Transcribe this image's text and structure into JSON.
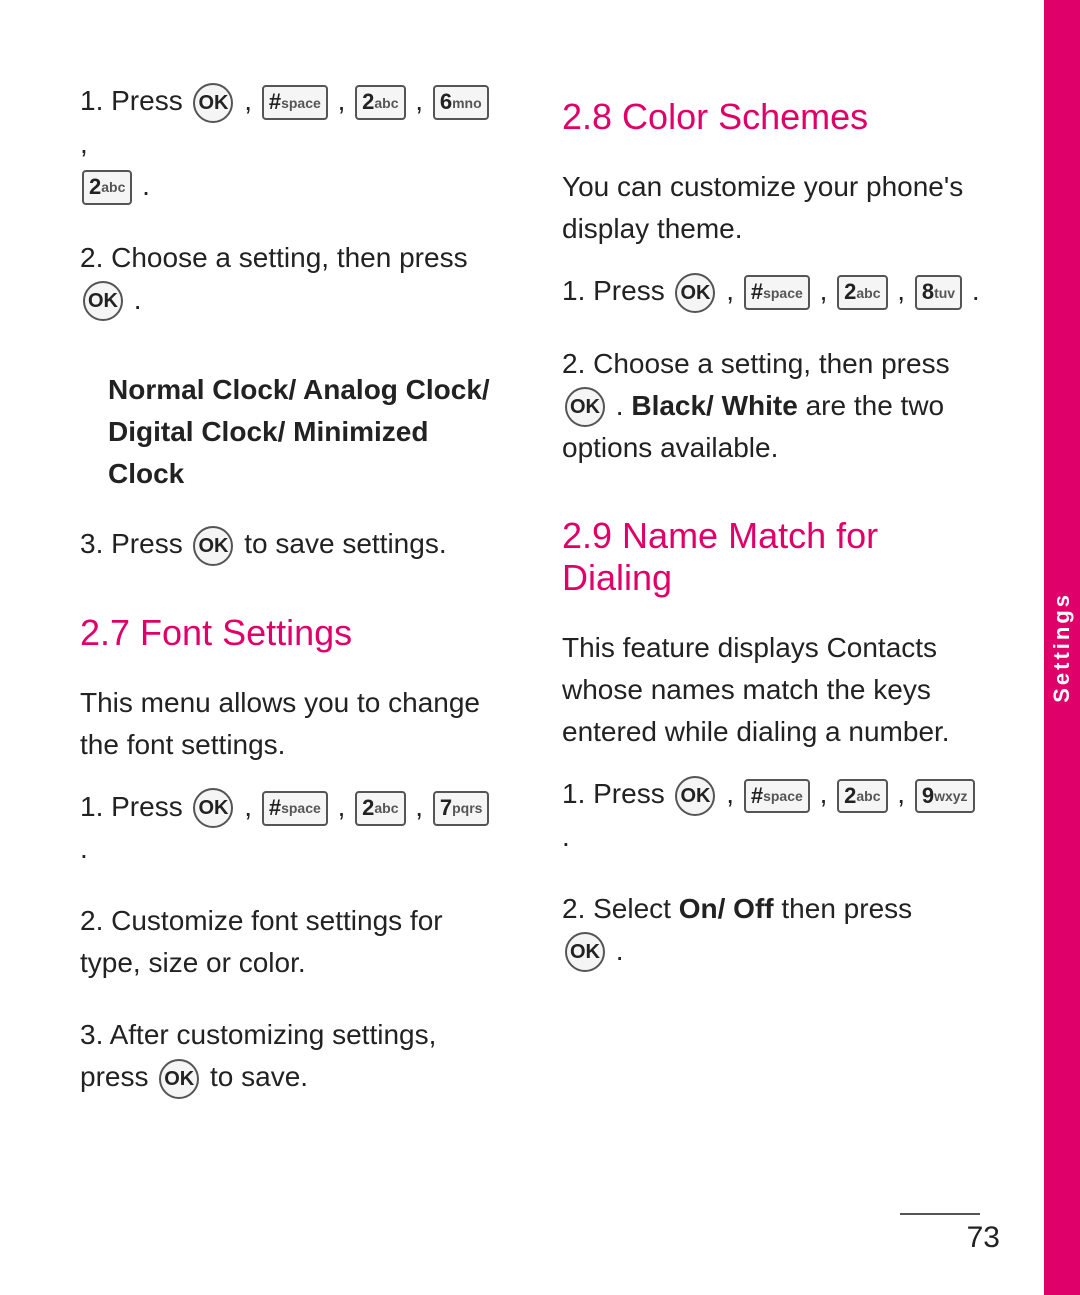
{
  "page": {
    "number": "73",
    "sidebar_label": "Settings"
  },
  "left_column": {
    "step1_prefix": "1. Press",
    "step1_keys": [
      "OK",
      "#space",
      "2abc",
      "6mno"
    ],
    "step1_suffix": "",
    "step1_extra_key": "2abc",
    "step2_prefix": "2. Choose a setting, then press",
    "step2_ok": "OK",
    "note_heading": "Normal Clock/ Analog Clock/ Digital Clock/ Minimized Clock",
    "step3": "3. Press",
    "step3_ok": "OK",
    "step3_suffix": "to save settings.",
    "section_27": "2.7 Font Settings",
    "font_intro": "This menu allows you to change the font settings.",
    "font_step1_prefix": "1. Press",
    "font_step1_keys": [
      "OK",
      "#space",
      "2abc",
      "7pqrs"
    ],
    "font_step2": "2. Customize font settings for type, size or color.",
    "font_step3_prefix": "3. After customizing settings, press",
    "font_step3_ok": "OK",
    "font_step3_suffix": "to save."
  },
  "right_column": {
    "section_28": "2.8 Color Schemes",
    "color_intro": "You can customize your phone's display theme.",
    "color_step1_prefix": "1. Press",
    "color_step1_keys": [
      "OK",
      "#space",
      "2abc",
      "8tuv"
    ],
    "color_step2_prefix": "2. Choose a setting, then press",
    "color_step2_ok": "OK",
    "color_step2_middle": ". Black/ White are the two options available.",
    "section_29": "2.9 Name Match for Dialing",
    "name_intro": "This feature displays Contacts whose names match the keys entered while dialing a number.",
    "name_step1_prefix": "1. Press",
    "name_step1_keys": [
      "OK",
      "#space",
      "2abc",
      "9wxyz"
    ],
    "name_step2_prefix": "2. Select",
    "name_step2_bold": "On/ Off",
    "name_step2_middle": "then press",
    "name_step2_ok": "OK"
  },
  "keys": {
    "ok_label": "OK",
    "hash_main": "#",
    "hash_sub": "space",
    "two_main": "2",
    "two_sub": "abc",
    "six_main": "6",
    "six_sub": "mno",
    "seven_main": "7",
    "seven_sub": "pqrs",
    "eight_main": "8",
    "eight_sub": "tuv",
    "nine_main": "9",
    "nine_sub": "wxyz"
  }
}
